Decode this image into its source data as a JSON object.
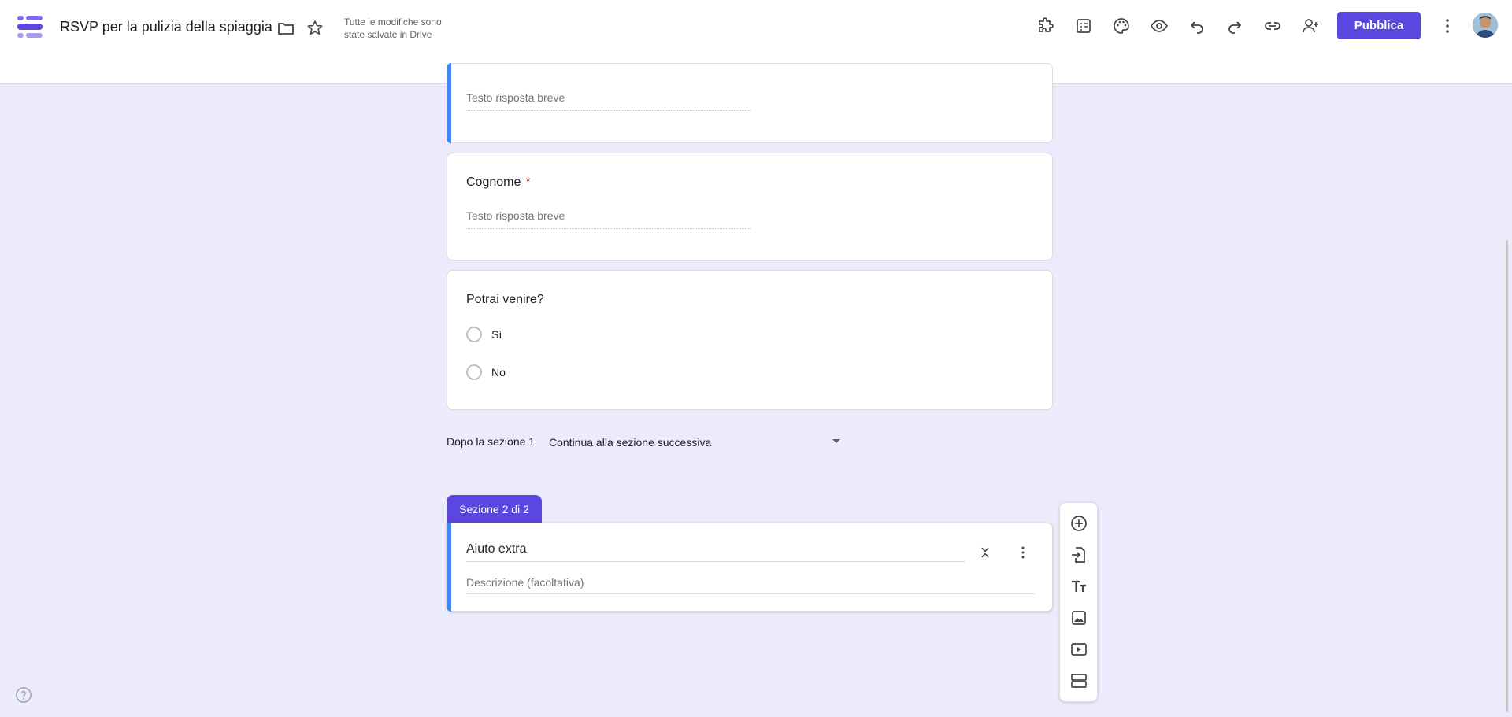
{
  "header": {
    "title": "RSVP per la pulizia della spiaggia",
    "save_status": "Tutte le modifiche sono state salvate in Drive",
    "publish_label": "Pubblica",
    "icons": [
      "folder-icon",
      "star-icon",
      "addons-icon",
      "sheet-template-icon",
      "palette-icon",
      "preview-icon",
      "undo-icon",
      "redo-icon",
      "link-icon",
      "add-collaborator-icon",
      "more-vert-icon"
    ],
    "accent_color": "#5b46e0"
  },
  "questions": [
    {
      "title": "",
      "placeholder": "Testo risposta breve"
    },
    {
      "title": "Cognome",
      "required_mark": "*",
      "placeholder": "Testo risposta breve"
    },
    {
      "title": "Potrai venire?",
      "options": [
        "Sì",
        "No"
      ]
    }
  ],
  "section_navigation": {
    "label": "Dopo la sezione 1",
    "selected": "Continua alla sezione successiva"
  },
  "section2": {
    "tab_label": "Sezione 2 di 2",
    "title": "Aiuto extra",
    "description_placeholder": "Descrizione (facoltativa)"
  },
  "toolbar": {
    "items": [
      "add-question-icon",
      "import-questions-icon",
      "add-title-icon",
      "add-image-icon",
      "add-video-icon",
      "add-section-icon"
    ]
  }
}
